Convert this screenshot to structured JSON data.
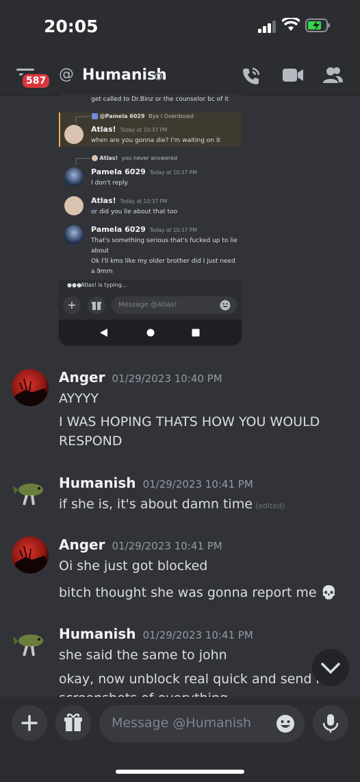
{
  "status_bar": {
    "time": "20:05"
  },
  "header": {
    "unread_badge": "587",
    "at_symbol": "@",
    "channel_name": "Humanish"
  },
  "embedded_screenshot": {
    "top_text": "get called to Dr.Binz or the counselor bc of it",
    "reply1_ref": "@Pamela 6029",
    "reply1_ref_text": "Bye I Overdosed",
    "msg1_name": "Atlas!",
    "msg1_time": "Today at 10:37 PM",
    "msg1_text": "when are you gonna die? I'm waiting on it",
    "reply2_ref": "Atlas!",
    "reply2_ref_text": "you never answered",
    "msg2_name": "Pamela 6029",
    "msg2_time": "Today at 10:37 PM",
    "msg2_text": "I don't reply.",
    "msg3_name": "Atlas!",
    "msg3_time": "Today at 10:37 PM",
    "msg3_text": "or did you lie about that too",
    "msg4_name": "Pamela 6029",
    "msg4_time": "Today at 10:37 PM",
    "msg4_line1": "That's something serious that's fucked up to lie",
    "msg4_line2": "about",
    "msg4_line3": "Ok I'll kms like my older brother did I just need",
    "msg4_line4": "a 9mm",
    "typing": "Atlas! is typing...",
    "placeholder": "Message @Atlas!"
  },
  "messages": [
    {
      "author": "Anger",
      "timestamp": "01/29/2023 10:40 PM",
      "lines": [
        "AYYYY",
        "I WAS HOPING THATS HOW YOU WOULD",
        "RESPOND"
      ]
    },
    {
      "author": "Humanish",
      "timestamp": "01/29/2023 10:41 PM",
      "lines": [
        "if she is, it's about damn time"
      ],
      "edited": "(edited)"
    },
    {
      "author": "Anger",
      "timestamp": "01/29/2023 10:41 PM",
      "lines": [
        "Oi she just got blocked",
        "bitch thought she was gonna report me"
      ],
      "emoji": "💀"
    },
    {
      "author": "Humanish",
      "timestamp": "01/29/2023 10:41 PM",
      "lines": [
        "she said the same to john",
        "okay, now unblock real quick and send me",
        "screenshots of everything"
      ]
    }
  ],
  "composer": {
    "placeholder": "Message @Humanish"
  },
  "colors": {
    "background": "#313338",
    "header": "#2b2d31",
    "badge": "#da373c",
    "highlight": "#3f3a2f"
  }
}
